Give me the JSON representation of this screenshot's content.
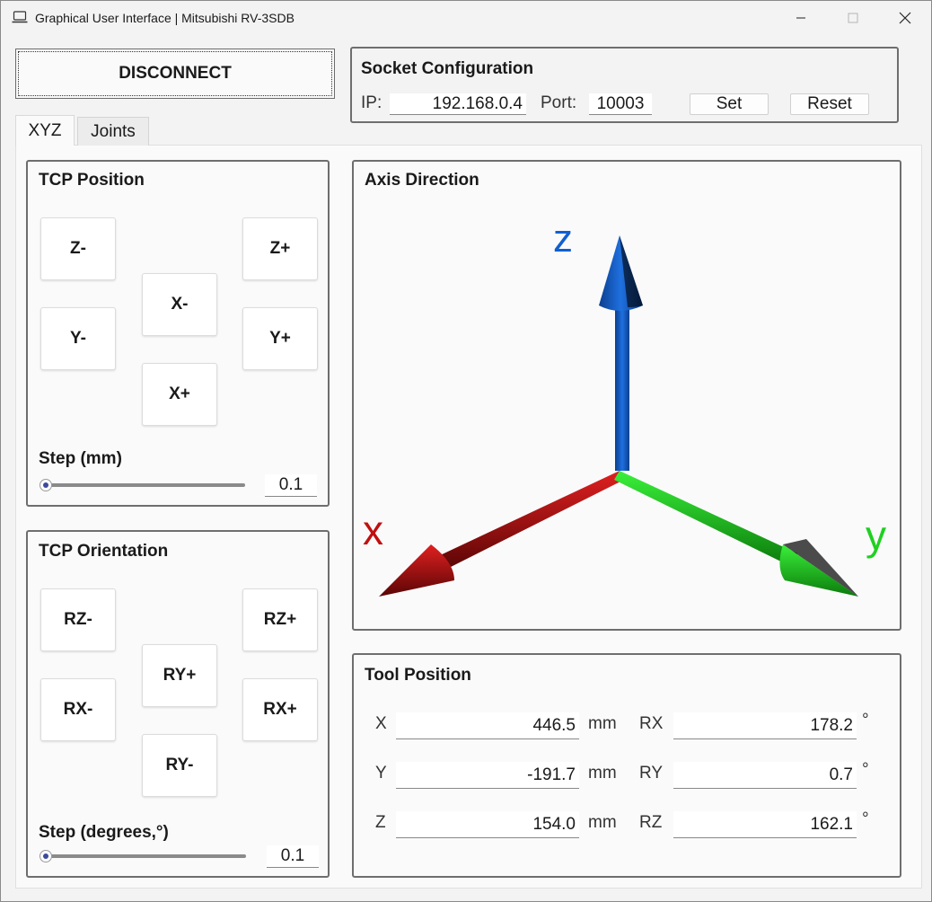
{
  "window": {
    "title": "Graphical User Interface | Mitsubishi RV-3SDB"
  },
  "connection": {
    "button_label": "DISCONNECT"
  },
  "socket": {
    "title": "Socket Configuration",
    "ip_label": "IP:",
    "ip_value": "192.168.0.4",
    "port_label": "Port:",
    "port_value": "10003",
    "set_label": "Set",
    "reset_label": "Reset"
  },
  "tabs": [
    {
      "label": "XYZ",
      "selected": true
    },
    {
      "label": "Joints",
      "selected": false
    }
  ],
  "tcp_position": {
    "title": "TCP Position",
    "buttons": {
      "z_minus": "Z-",
      "z_plus": "Z+",
      "x_minus": "X-",
      "y_minus": "Y-",
      "y_plus": "Y+",
      "x_plus": "X+"
    },
    "step_label": "Step (mm)",
    "step_value": "0.1",
    "slider_fraction": 0.0
  },
  "tcp_orientation": {
    "title": "TCP Orientation",
    "buttons": {
      "rz_minus": "RZ-",
      "rz_plus": "RZ+",
      "ry_plus": "RY+",
      "rx_minus": "RX-",
      "rx_plus": "RX+",
      "ry_minus": "RY-"
    },
    "step_label": "Step (degrees,°)",
    "step_value": "0.1",
    "slider_fraction": 0.0
  },
  "axis_direction": {
    "title": "Axis Direction",
    "labels": {
      "z": "z",
      "x": "x",
      "y": "y"
    },
    "colors": {
      "z": "#1060d0",
      "x": "#c01010",
      "y": "#20d020"
    }
  },
  "tool_position": {
    "title": "Tool Position",
    "rows": [
      {
        "label": "X",
        "value": "446.5",
        "unit": "mm",
        "rlabel": "RX",
        "rvalue": "178.2",
        "runit": "°"
      },
      {
        "label": "Y",
        "value": "-191.7",
        "unit": "mm",
        "rlabel": "RY",
        "rvalue": "0.7",
        "runit": "°"
      },
      {
        "label": "Z",
        "value": "154.0",
        "unit": "mm",
        "rlabel": "RZ",
        "rvalue": "162.1",
        "runit": "°"
      }
    ]
  }
}
